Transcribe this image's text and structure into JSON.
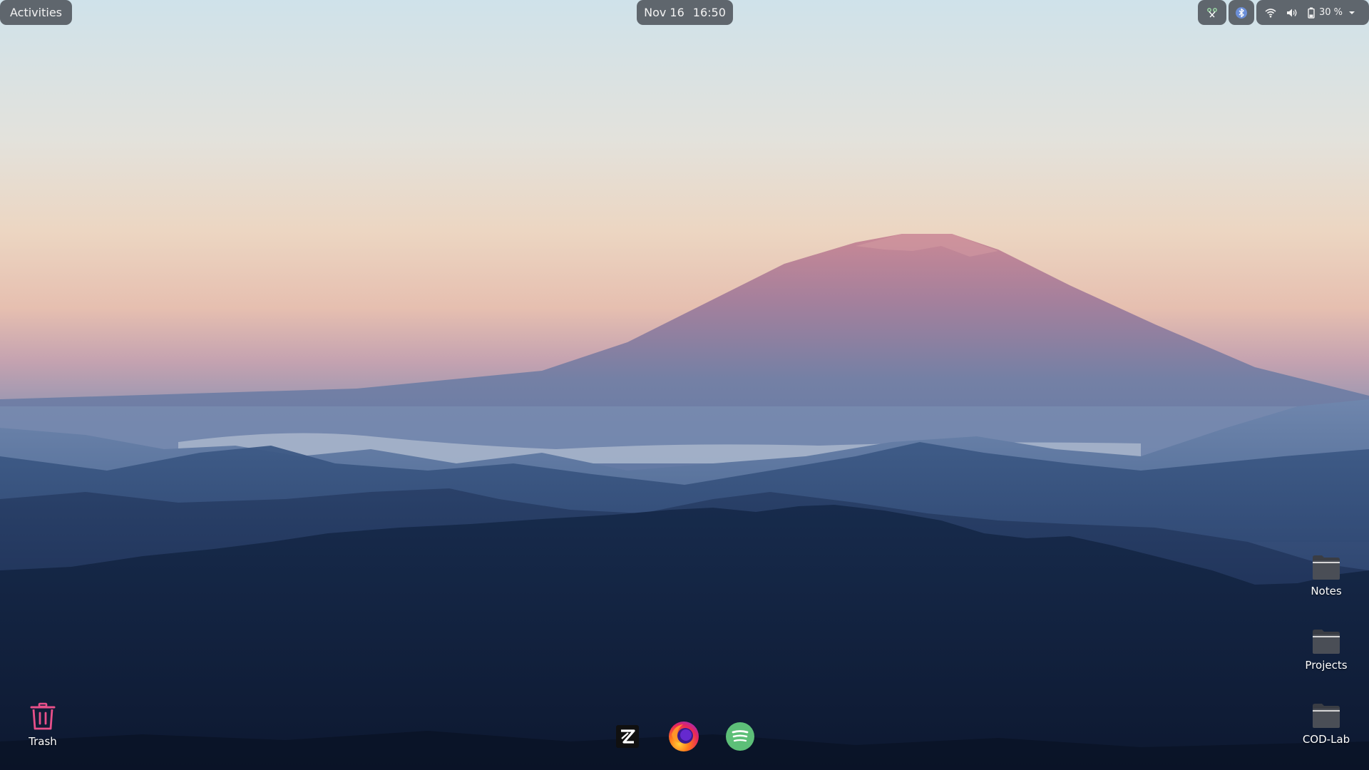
{
  "topbar": {
    "activities_label": "Activities",
    "clock": {
      "date": "Nov 16",
      "time": "16:50"
    },
    "tray": {
      "extension_icon": "extension-icon",
      "bluetooth_icon": "bluetooth-icon",
      "wifi_icon": "wifi-icon",
      "volume_icon": "volume-icon",
      "battery_icon": "battery-icon",
      "battery_percent": "30 %",
      "menu_icon": "chevron-down-icon"
    }
  },
  "desktop": {
    "icons": [
      {
        "label": "Trash",
        "icon": "trash-icon"
      },
      {
        "label": "Notes",
        "icon": "folder-icon"
      },
      {
        "label": "Projects",
        "icon": "folder-icon"
      },
      {
        "label": "COD-Lab",
        "icon": "folder-icon"
      }
    ]
  },
  "dock": {
    "items": [
      {
        "app": "zed",
        "icon": "zed-icon"
      },
      {
        "app": "firefox",
        "icon": "firefox-icon"
      },
      {
        "app": "spotify",
        "icon": "spotify-icon"
      }
    ]
  },
  "colors": {
    "panel_bg": "#464a52",
    "trash_accent": "#e8508a",
    "spotify_green": "#5dbf78",
    "sky_top": "#d2e3ea",
    "sky_horizon": "#e8c6b0",
    "mountain_peak": "#c58a96",
    "foreground_ridge": "#0f1c33"
  }
}
